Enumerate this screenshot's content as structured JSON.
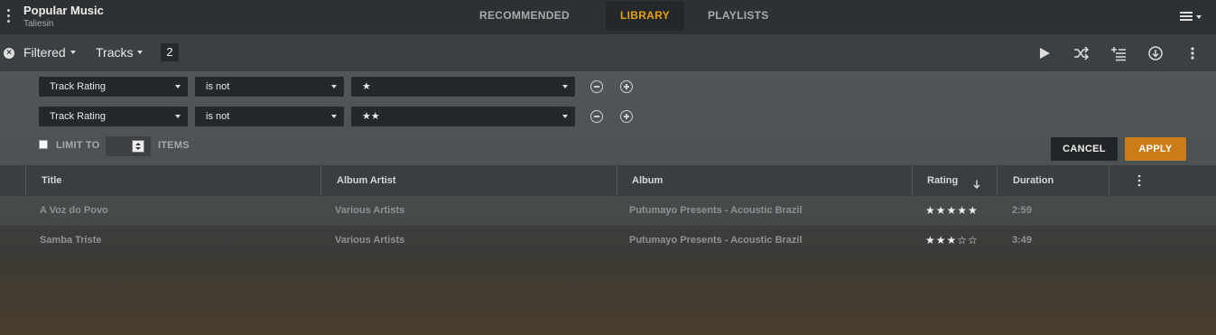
{
  "header": {
    "title": "Popular Music",
    "subtitle": "Taliesin",
    "tabs": [
      {
        "label": "RECOMMENDED",
        "active": false
      },
      {
        "label": "LIBRARY",
        "active": true
      },
      {
        "label": "PLAYLISTS",
        "active": false
      }
    ]
  },
  "filterbar": {
    "filter_label": "Filtered",
    "type_label": "Tracks",
    "count": "2",
    "actions": [
      "play-icon",
      "shuffle-icon",
      "add-to-queue-icon",
      "download-icon",
      "more-icon"
    ]
  },
  "rules": [
    {
      "field": "Track Rating",
      "operator": "is not",
      "value": "★"
    },
    {
      "field": "Track Rating",
      "operator": "is not",
      "value": "★★"
    }
  ],
  "limit": {
    "prefix": "LIMIT TO",
    "suffix": "ITEMS",
    "value": "",
    "checked": false
  },
  "buttons": {
    "cancel": "CANCEL",
    "apply": "APPLY"
  },
  "colors": {
    "accent": "#e5a00d",
    "apply": "#cc7b19"
  },
  "table": {
    "columns": [
      "Title",
      "Album Artist",
      "Album",
      "Rating",
      "Duration"
    ],
    "sorted_by": "Rating",
    "sort_direction": "descending",
    "rows": [
      {
        "title": "A Voz do Povo",
        "artist": "Various Artists",
        "album": "Putumayo Presents - Acoustic Brazil",
        "rating": "★★★★★",
        "rating_value": 5,
        "duration": "2:59"
      },
      {
        "title": "Samba Triste",
        "artist": "Various Artists",
        "album": "Putumayo Presents - Acoustic Brazil",
        "rating": "★★★☆☆",
        "rating_value": 3,
        "duration": "3:49"
      }
    ]
  }
}
